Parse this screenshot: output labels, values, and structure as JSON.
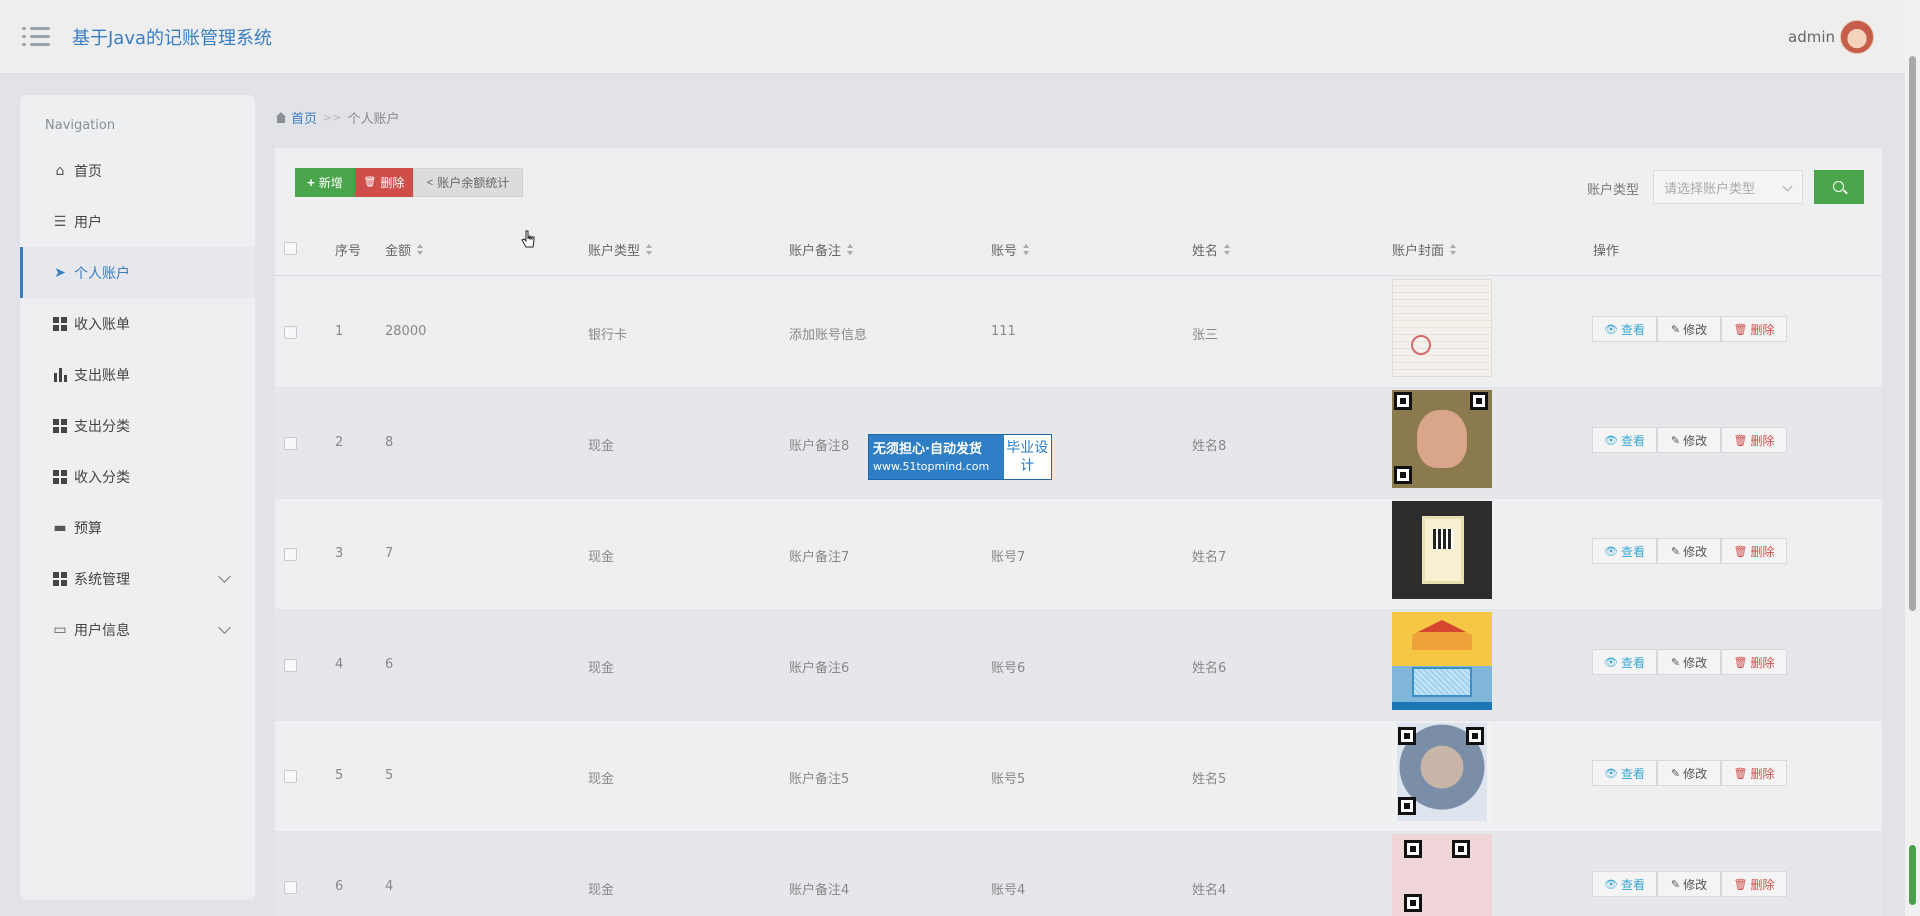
{
  "header": {
    "app_title": "基于Java的记账管理系统",
    "username": "admin"
  },
  "sidebar": {
    "heading": "Navigation",
    "items": [
      {
        "label": "首页",
        "icon": "home-icon"
      },
      {
        "label": "用户",
        "icon": "sliders-icon"
      },
      {
        "label": "个人账户",
        "icon": "paper-plane-icon",
        "active": true
      },
      {
        "label": "收入账单",
        "icon": "grid-icon"
      },
      {
        "label": "支出账单",
        "icon": "bar-chart-icon"
      },
      {
        "label": "支出分类",
        "icon": "grid-icon"
      },
      {
        "label": "收入分类",
        "icon": "grid-icon"
      },
      {
        "label": "预算",
        "icon": "monitor-icon"
      },
      {
        "label": "系统管理",
        "icon": "grid-icon",
        "expandable": true
      },
      {
        "label": "用户信息",
        "icon": "card-icon",
        "expandable": true
      }
    ]
  },
  "breadcrumb": {
    "home": "首页",
    "separator": ">>",
    "current": "个人账户"
  },
  "toolbar": {
    "add_label": "新增",
    "delete_label": "删除",
    "stats_label": "账户余额统计",
    "filter_label": "账户类型",
    "filter_placeholder": "请选择账户类型"
  },
  "table": {
    "columns": [
      "序号",
      "金额",
      "账户类型",
      "账户备注",
      "账号",
      "姓名",
      "账户封面",
      "操作"
    ],
    "rows": [
      {
        "index": "1",
        "amount": "28000",
        "type": "银行卡",
        "note": "添加账号信息",
        "account": "111",
        "name": "张三"
      },
      {
        "index": "2",
        "amount": "8",
        "type": "现金",
        "note": "账户备注8",
        "account": "",
        "name": "姓名8"
      },
      {
        "index": "3",
        "amount": "7",
        "type": "现金",
        "note": "账户备注7",
        "account": "账号7",
        "name": "姓名7"
      },
      {
        "index": "4",
        "amount": "6",
        "type": "现金",
        "note": "账户备注6",
        "account": "账号6",
        "name": "姓名6"
      },
      {
        "index": "5",
        "amount": "5",
        "type": "现金",
        "note": "账户备注5",
        "account": "账号5",
        "name": "姓名5"
      },
      {
        "index": "6",
        "amount": "4",
        "type": "现金",
        "note": "账户备注4",
        "account": "账号4",
        "name": "姓名4"
      }
    ],
    "actions": {
      "view": "查看",
      "edit": "修改",
      "delete": "删除"
    }
  },
  "watermark": {
    "line1": "无须担心·自动发货",
    "line2": "www.51topmind.com",
    "side": "毕业设计"
  },
  "colors": {
    "accent": "#3a7ec2",
    "success": "#4ba64b",
    "danger": "#cf4e4a"
  }
}
